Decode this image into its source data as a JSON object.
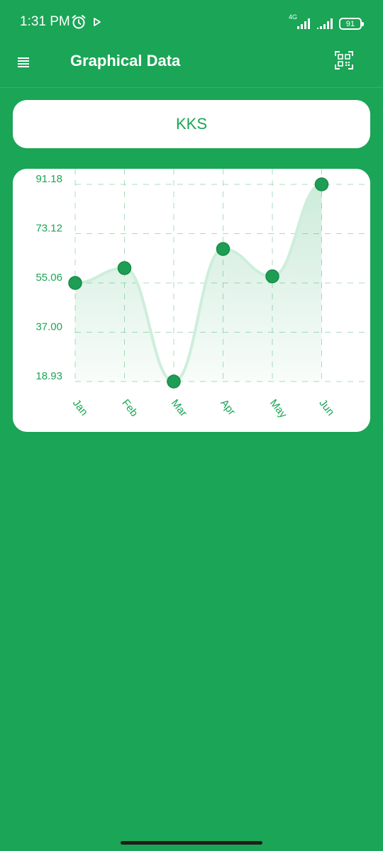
{
  "status_bar": {
    "time": "1:31 PM",
    "network": "4G",
    "battery": "91",
    "icons": [
      "alarm-icon",
      "play-icon",
      "signal-icon",
      "battery-icon"
    ]
  },
  "app_bar": {
    "title": "Graphical Data",
    "icons": [
      "menu-icon",
      "qr-code-icon"
    ]
  },
  "card": {
    "name": "KKS"
  },
  "colors": {
    "primary": "#1ba556",
    "dot": "#1e9e55",
    "line": "#cdeedb",
    "grid": "#a9dcbd"
  },
  "chart_data": {
    "type": "line",
    "categories": [
      "Jan",
      "Feb",
      "Mar",
      "Apr",
      "May",
      "Jun"
    ],
    "values": [
      55.06,
      60.5,
      18.93,
      67.5,
      57.5,
      91.18
    ],
    "y_tick_labels": [
      "91.18",
      "73.12",
      "55.06",
      "37.00",
      "18.93"
    ],
    "y_ticks": [
      91.18,
      73.12,
      55.06,
      37.0,
      18.93
    ],
    "ylim": [
      18.93,
      91.18
    ],
    "curve": "smooth",
    "area_fill": true,
    "grid": true
  }
}
